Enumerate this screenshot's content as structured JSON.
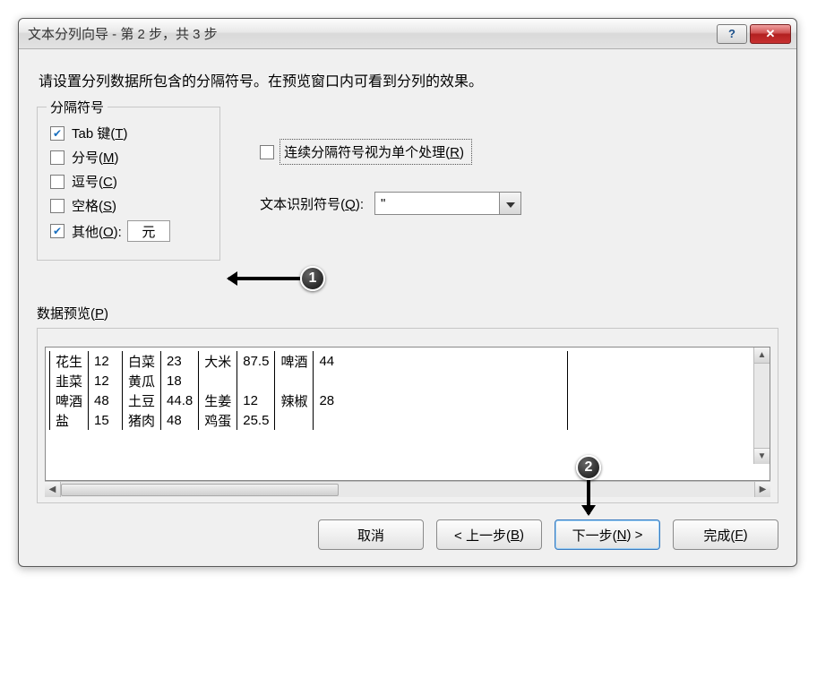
{
  "titlebar": {
    "title": "文本分列向导 - 第 2 步，共 3 步",
    "help_symbol": "?",
    "close_symbol": "✕"
  },
  "instruction": "请设置分列数据所包含的分隔符号。在预览窗口内可看到分列的效果。",
  "delim_group": {
    "legend": "分隔符号",
    "tab": {
      "label": "Tab 键(T)",
      "checked": true
    },
    "semicolon": {
      "label": "分号(M)",
      "checked": false
    },
    "comma": {
      "label": "逗号(C)",
      "checked": false
    },
    "space": {
      "label": "空格(S)",
      "checked": false
    },
    "other": {
      "label": "其他(O):",
      "checked": true,
      "value": "元"
    }
  },
  "consecutive": {
    "label": "连续分隔符号视为单个处理(R)",
    "checked": false
  },
  "text_qualifier": {
    "label": "文本识别符号(Q):",
    "value": "\""
  },
  "preview": {
    "legend": "数据预览(P)",
    "rows": [
      [
        "花生",
        "12",
        "白菜",
        "23",
        "大米",
        "87.5",
        "啤酒",
        "44"
      ],
      [
        "韭菜",
        "12",
        "黄瓜",
        "18",
        "",
        "",
        "",
        ""
      ],
      [
        "啤酒",
        "48",
        "土豆",
        "44.8",
        "生姜",
        "12",
        "辣椒",
        "28"
      ],
      [
        "盐",
        "15",
        "猪肉",
        "48",
        "鸡蛋",
        "25.5",
        "",
        ""
      ]
    ]
  },
  "buttons": {
    "cancel": "取消",
    "back": "< 上一步(B)",
    "next": "下一步(N) >",
    "finish": "完成(F)"
  },
  "callouts": {
    "one": "1",
    "two": "2"
  }
}
